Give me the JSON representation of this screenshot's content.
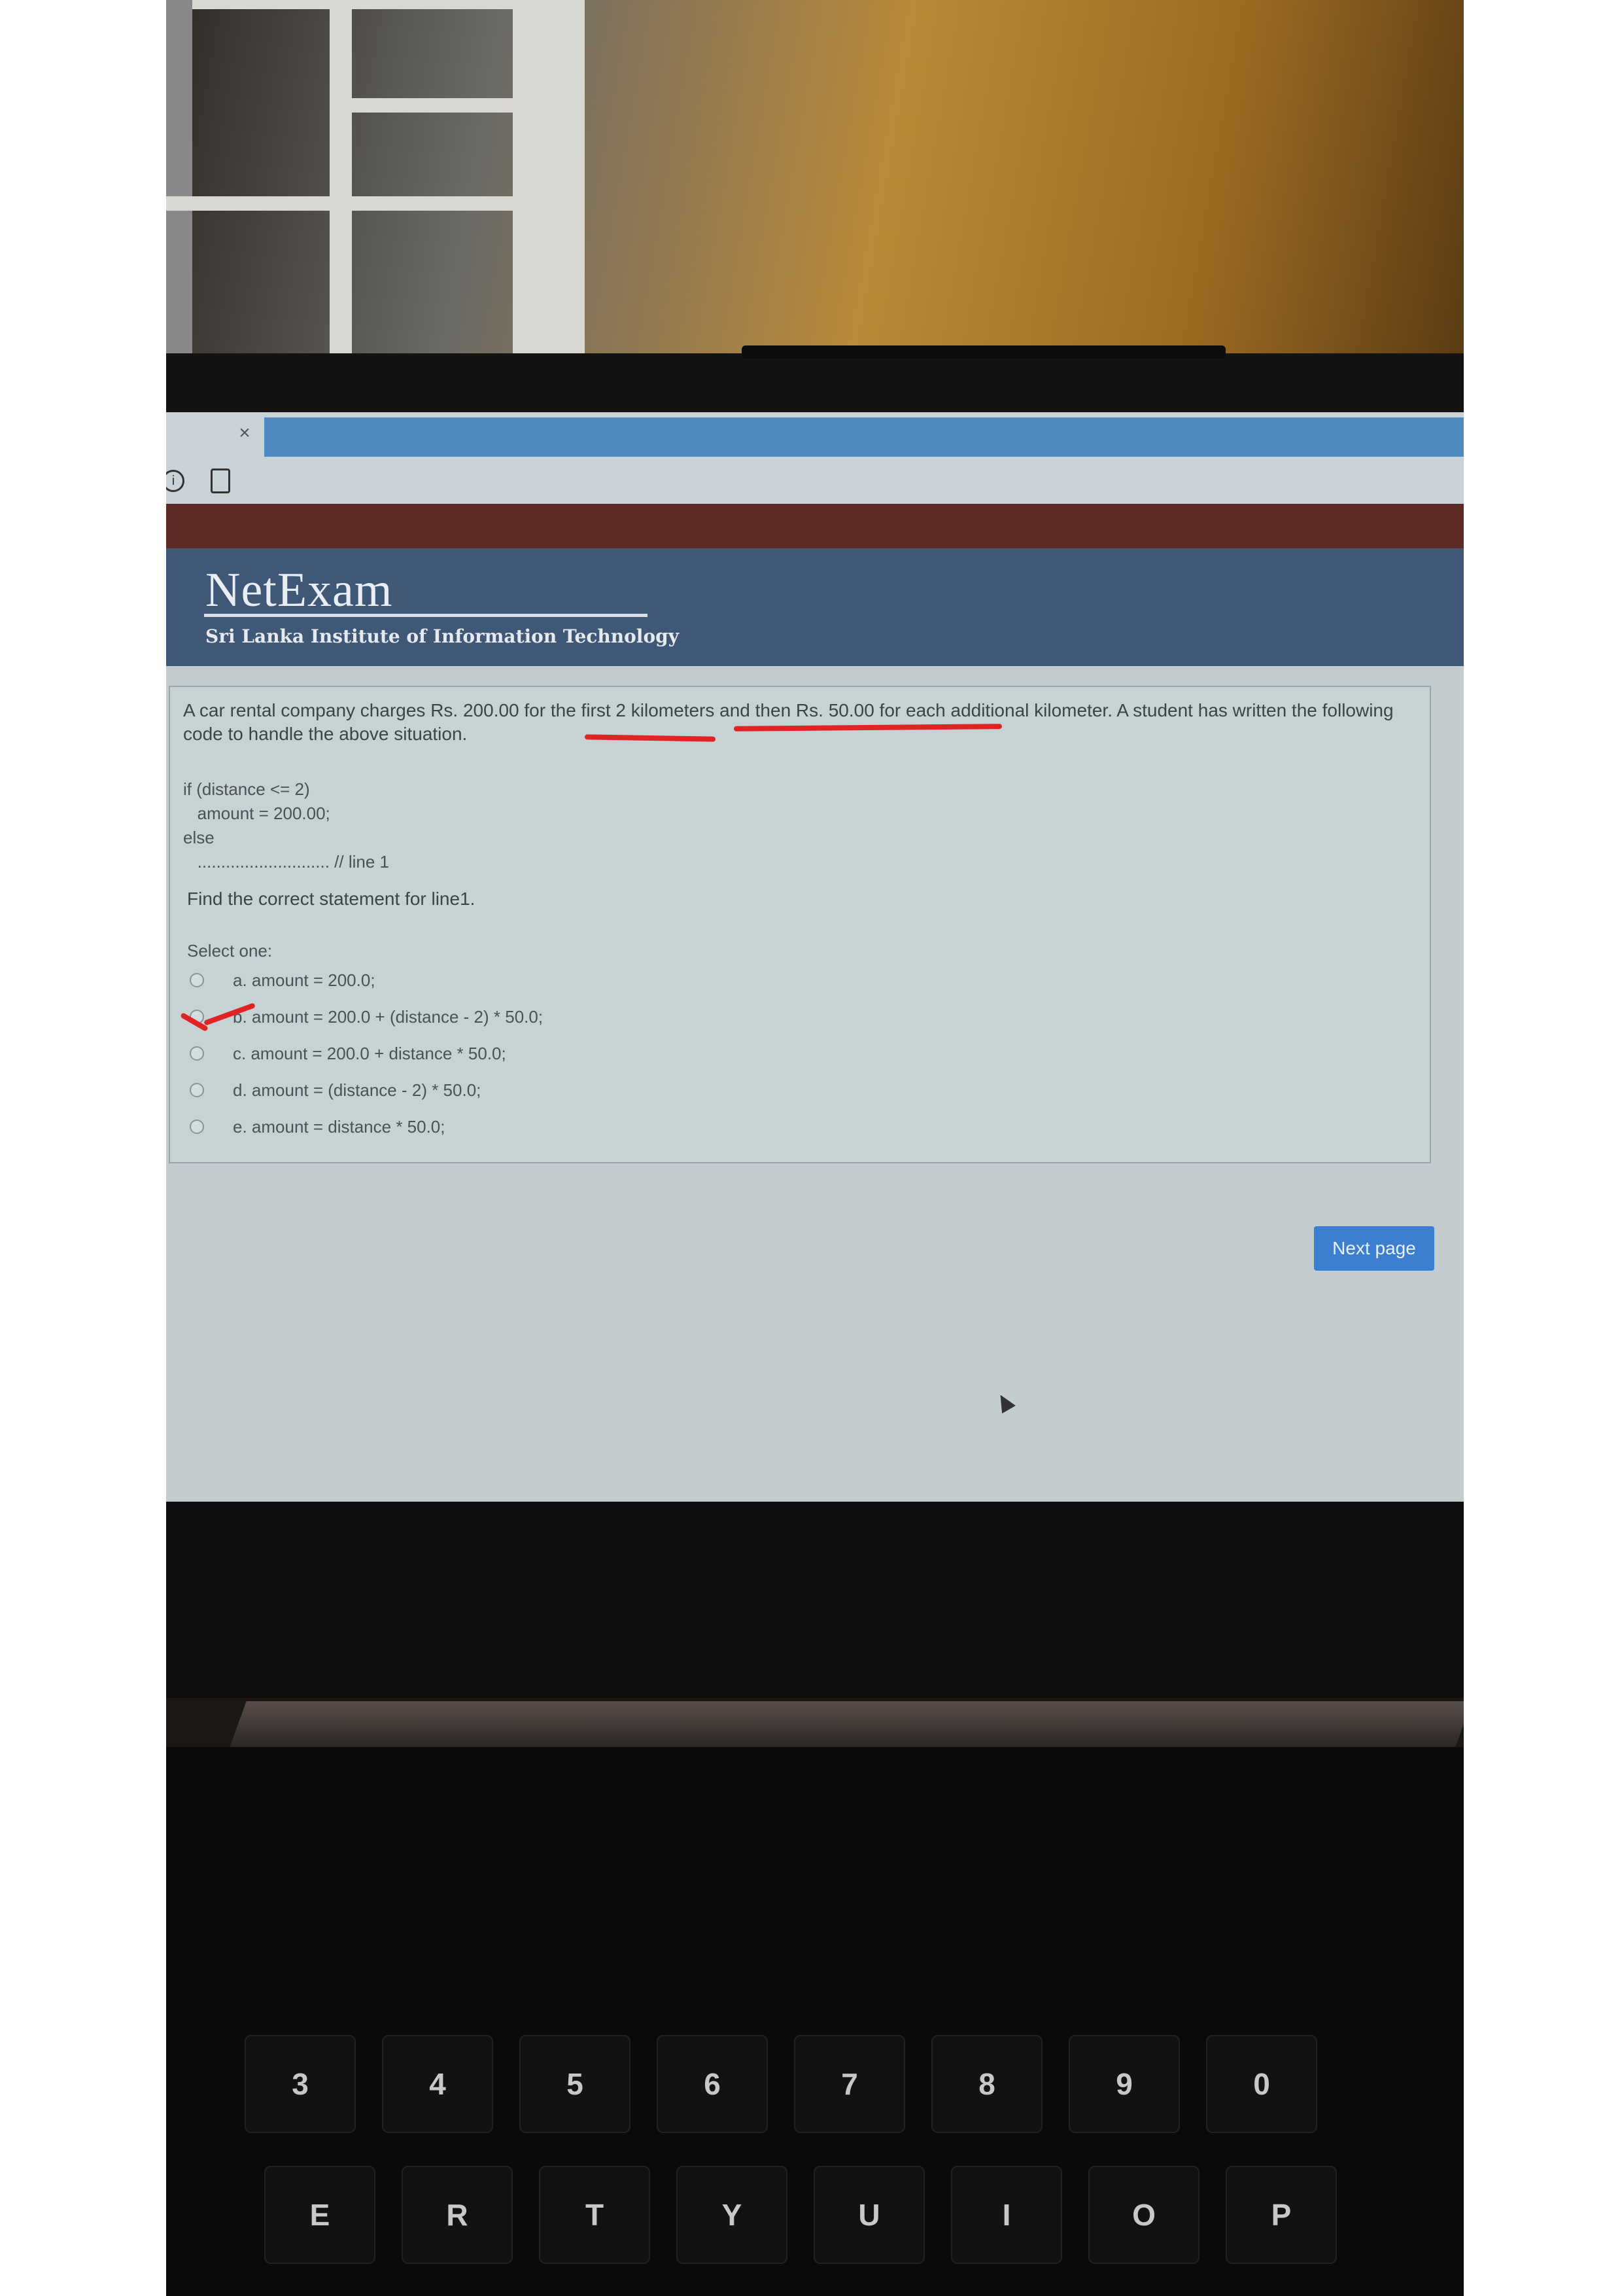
{
  "netexam": {
    "logo": "NetExam",
    "subtitle": "Sri Lanka Institute of Information Technology"
  },
  "browser": {
    "tab_close": "×",
    "info_icon": "i"
  },
  "question": {
    "text": "A car rental company charges Rs. 200.00 for the first 2 kilometers and then Rs. 50.00 for each additional kilometer. A student has written the following code to handle the above situation.",
    "code_line1": "if (distance <= 2)",
    "code_line2": "   amount = 200.00;",
    "code_line3": "else",
    "code_line4": "   ............................ // line 1",
    "prompt": "Find the correct statement for line1.",
    "select_one": "Select one:",
    "options": [
      {
        "label": "a. amount = 200.0;"
      },
      {
        "label": "b. amount = 200.0 + (distance - 2) * 50.0;"
      },
      {
        "label": "c. amount = 200.0 + distance * 50.0;"
      },
      {
        "label": "d. amount = (distance - 2) * 50.0;"
      },
      {
        "label": "e. amount = distance * 50.0;"
      }
    ]
  },
  "next_button": "Next page",
  "keyboard": {
    "row_numbers": [
      "3",
      "4",
      "5",
      "6",
      "7",
      "8",
      "9",
      "0"
    ],
    "row_letters": [
      "E",
      "R",
      "T",
      "Y",
      "U",
      "I",
      "O",
      "P"
    ]
  },
  "colors": {
    "header_bg": "#3f5877",
    "maroon_strip": "#5e2a26",
    "next_button": "#3c7fd0",
    "annotation_ink": "#e02424"
  }
}
